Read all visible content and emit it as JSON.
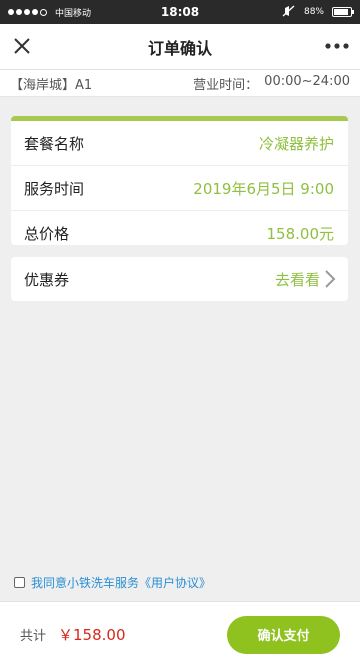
{
  "status_bar": {
    "carrier": "中国移动",
    "time": "18:08",
    "battery": "88%",
    "battery_level": 0.88
  },
  "navbar": {
    "title": "订单确认",
    "close_icon": "close-icon",
    "more_icon": "more-dots-icon"
  },
  "store": {
    "name": "【海岸城】A1",
    "hours_label": "营业时间：",
    "hours_value": "00:00~24:00"
  },
  "order": {
    "rows": [
      {
        "label": "套餐名称",
        "value": "冷凝器养护"
      },
      {
        "label": "服务时间",
        "value": "2019年6月5日 9:00"
      },
      {
        "label": "总价格",
        "value": "158.00元"
      }
    ]
  },
  "coupon": {
    "label": "优惠券",
    "action": "去看看",
    "icon": "chevron-right-icon"
  },
  "agreement": {
    "text": "我同意小铁洗车服务《用户协议》",
    "checked": false
  },
  "footer": {
    "total_label": "共计",
    "total_amount": "￥158.00",
    "pay_button": "确认支付"
  },
  "colors": {
    "accent_green": "#8fc03f",
    "price_red": "#d9261c",
    "link_blue": "#2a8fd4"
  }
}
